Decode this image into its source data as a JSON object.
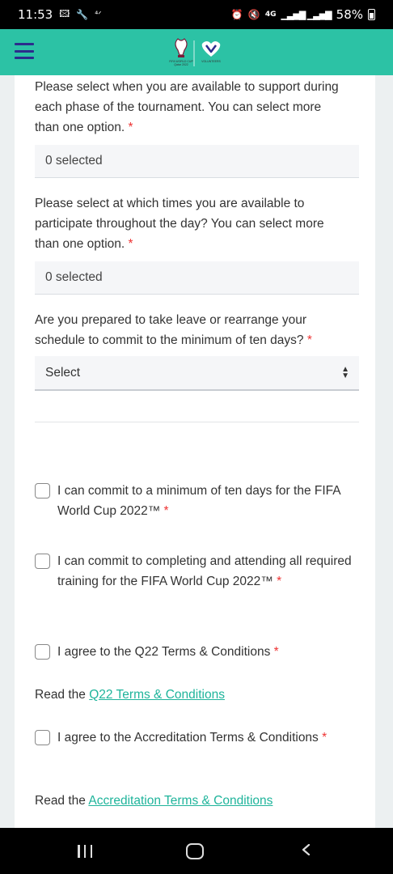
{
  "status_bar": {
    "time": "11:53",
    "network": "4G",
    "battery": "58%",
    "icons": [
      "image-icon",
      "wrench-icon",
      "signal-small-icon",
      "alarm-icon",
      "mute-icon",
      "signal-bars-icon",
      "battery-icon"
    ]
  },
  "header": {
    "menu_icon": "hamburger-menu-icon",
    "logo_icon": "fifa-volunteers-logo"
  },
  "form": {
    "q_phases": {
      "label": "Please select when you are available to support during each phase of the tournament. You can select more than one option.",
      "required": "*",
      "value": "0 selected"
    },
    "q_times": {
      "label": "Please select at which times you are available to participate throughout the day? You can select more than one option.",
      "required": "*",
      "value": "0 selected"
    },
    "q_leave": {
      "label": "Are you prepared to take leave or rearrange your schedule to commit to the minimum of ten days?",
      "required": "*",
      "value": "Select"
    },
    "checks": [
      {
        "label": "I can commit to a minimum of ten days for the FIFA World Cup 2022™",
        "required": "*",
        "checked": false
      },
      {
        "label": "I can commit to completing and attending all required training for the FIFA World Cup 2022™",
        "required": "*",
        "checked": false
      },
      {
        "label": "I agree to the Q22 Terms & Conditions",
        "required": "*",
        "checked": false
      },
      {
        "label": "I agree to the Accreditation Terms & Conditions",
        "required": "*",
        "checked": false
      }
    ],
    "read_q22": {
      "prefix": "Read the",
      "link": "Q22 Terms & Conditions"
    },
    "read_accreditation": {
      "prefix": "Read the",
      "link": "Accreditation Terms & Conditions"
    }
  },
  "colors": {
    "header_bg": "#2cc2a5",
    "link": "#1fb49b",
    "required": "#e33333",
    "menu_icon": "#2c2c8c"
  }
}
